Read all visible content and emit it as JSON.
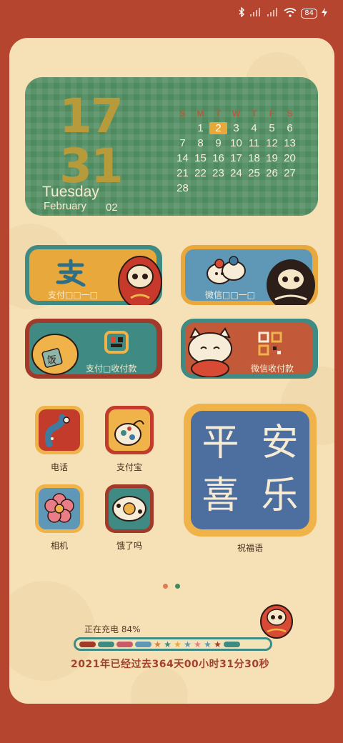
{
  "status": {
    "battery": "84"
  },
  "clock": {
    "hour": "17",
    "minute": "31",
    "weekday": "Tuesday",
    "month": "February",
    "day": "02"
  },
  "calendar": {
    "headers": [
      "S",
      "M",
      "T",
      "W",
      "T",
      "F",
      "S"
    ],
    "rows": [
      [
        "",
        "1",
        "2",
        "3",
        "4",
        "5",
        "6"
      ],
      [
        "7",
        "8",
        "9",
        "10",
        "11",
        "12",
        "13"
      ],
      [
        "14",
        "15",
        "16",
        "17",
        "18",
        "19",
        "20"
      ],
      [
        "21",
        "22",
        "23",
        "24",
        "25",
        "26",
        "27"
      ],
      [
        "28",
        "",
        "",
        "",
        "",
        "",
        ""
      ]
    ],
    "today": "2"
  },
  "pay": {
    "alipay_scan": "支付□□一□",
    "wechat_scan": "微信□□一□",
    "alipay_collect": "支付□收付款",
    "wechat_collect": "微信收付款"
  },
  "apps": {
    "phone": "电话",
    "alipay": "支付宝",
    "camera": "相机",
    "eleme": "饿了吗"
  },
  "blessing": {
    "chars": [
      "平",
      "安",
      "喜",
      "乐"
    ],
    "label": "祝福语"
  },
  "pages": {
    "current": 1,
    "total": 2
  },
  "charging": {
    "text": "正在充电 84%",
    "level": 0.84
  },
  "year": {
    "text": "2021年已经过去364天00小时31分30秒"
  },
  "colors": {
    "bg": "#b5452f",
    "card": "#f6e1b6",
    "green": "#4e8a5e",
    "teal": "#3f8a82",
    "mustard": "#e8a93a",
    "blue": "#4d6fa0"
  }
}
